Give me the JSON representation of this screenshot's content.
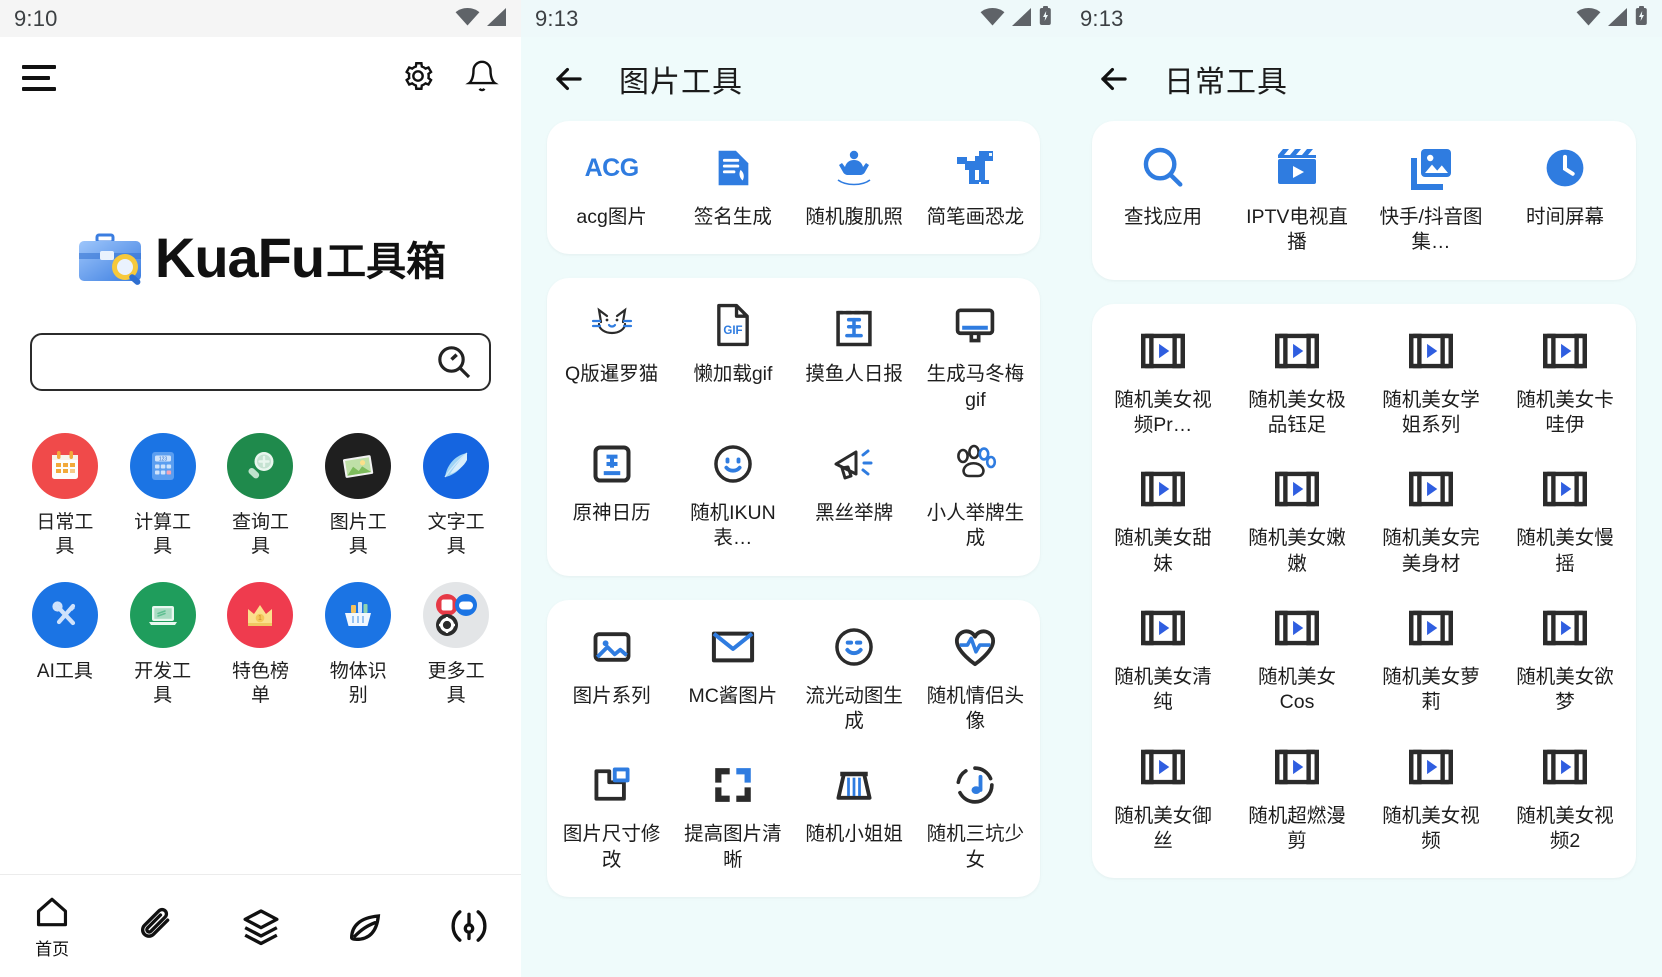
{
  "theme": {
    "accent_blue": "#2f7ce0",
    "panel_bg": "#effbfb",
    "card_bg": "#ffffff",
    "text": "#1d1d1d"
  },
  "panel1": {
    "status": {
      "time": "9:10",
      "icons": [
        "wifi-icon",
        "signal-icon"
      ]
    },
    "appbar": {
      "menu": "menu-icon",
      "settings": "gear-icon",
      "notifications": "bell-icon"
    },
    "brand": {
      "name": "KuaFu",
      "suffix": "工具箱",
      "icon": "briefcase-search-icon"
    },
    "search": {
      "value": "",
      "placeholder": "",
      "button": "search-icon"
    },
    "categories": [
      {
        "label": "日常工具",
        "icon": "calendar-icon",
        "color": "#f04a4a"
      },
      {
        "label": "计算工具",
        "icon": "calculator-icon",
        "color": "#1b74e4"
      },
      {
        "label": "查询工具",
        "icon": "magnifier-plus-icon",
        "color": "#1f8a4c"
      },
      {
        "label": "图片工具",
        "icon": "photo-stack-icon",
        "color": "#1f1f1f"
      },
      {
        "label": "文字工具",
        "icon": "feather-icon",
        "color": "#1565e0"
      },
      {
        "label": "AI工具",
        "icon": "wrench-screwdriver-icon",
        "color": "#1b74e4"
      },
      {
        "label": "开发工具",
        "icon": "laptop-icon",
        "color": "#1f9d5c"
      },
      {
        "label": "特色榜单",
        "icon": "crown-icon",
        "color": "#ef3b4e"
      },
      {
        "label": "物体识别",
        "icon": "basket-icon",
        "color": "#1b74e4"
      },
      {
        "label": "更多工具",
        "icon": "more-apps-icon",
        "color": "#e3e5e7"
      }
    ],
    "bottom_nav": [
      {
        "label": "首页",
        "icon": "home-icon",
        "active": true
      },
      {
        "label": "",
        "icon": "paperclip-icon",
        "active": false
      },
      {
        "label": "",
        "icon": "layers-icon",
        "active": false
      },
      {
        "label": "",
        "icon": "leaf-icon",
        "active": false
      },
      {
        "label": "",
        "icon": "compass-icon",
        "active": false
      }
    ]
  },
  "panel2": {
    "status": {
      "time": "9:13",
      "icons": [
        "wifi-icon",
        "signal-icon",
        "battery-charging-icon"
      ]
    },
    "title": "图片工具",
    "back": "back-arrow-icon",
    "cards": [
      {
        "tools": [
          {
            "label": "acg图片",
            "icon": "acg-text-icon"
          },
          {
            "label": "签名生成",
            "icon": "signature-doc-icon"
          },
          {
            "label": "随机腹肌照",
            "icon": "muscle-flex-icon"
          },
          {
            "label": "简笔画恐龙",
            "icon": "dinosaur-icon"
          }
        ]
      },
      {
        "tools": [
          {
            "label": "Q版暹罗猫",
            "icon": "cat-face-icon"
          },
          {
            "label": "懒加载gif",
            "icon": "gif-file-icon"
          },
          {
            "label": "摸鱼人日报",
            "icon": "calendar-day-icon"
          },
          {
            "label": "生成马冬梅gif",
            "icon": "monitor-icon"
          },
          {
            "label": "原神日历",
            "icon": "day-card-icon"
          },
          {
            "label": "随机IKUN表…",
            "icon": "smiley-icon"
          },
          {
            "label": "黑丝举牌",
            "icon": "megaphone-icon"
          },
          {
            "label": "小人举牌生成",
            "icon": "paw-icon"
          }
        ]
      },
      {
        "tools": [
          {
            "label": "图片系列",
            "icon": "image-icon"
          },
          {
            "label": "MC酱图片",
            "icon": "envelope-icon"
          },
          {
            "label": "流光动图生成",
            "icon": "smiley-round-icon"
          },
          {
            "label": "随机情侣头像",
            "icon": "heart-pulse-icon"
          },
          {
            "label": "图片尺寸修改",
            "icon": "resize-icon"
          },
          {
            "label": "提高图片清晰",
            "icon": "fullscreen-icon"
          },
          {
            "label": "随机小姐姐",
            "icon": "skirt-icon"
          },
          {
            "label": "随机三坑少女",
            "icon": "music-disc-icon"
          }
        ]
      }
    ]
  },
  "panel3": {
    "status": {
      "time": "9:13",
      "icons": [
        "wifi-icon",
        "signal-icon",
        "battery-charging-icon"
      ]
    },
    "title": "日常工具",
    "back": "back-arrow-icon",
    "cards": [
      {
        "tools": [
          {
            "label": "查找应用",
            "icon": "magnifier-icon"
          },
          {
            "label": "IPTV电视直播",
            "icon": "clapboard-play-icon"
          },
          {
            "label": "快手/抖音图集…",
            "icon": "photo-stack-icon"
          },
          {
            "label": "时间屏幕",
            "icon": "clock-icon"
          }
        ]
      },
      {
        "tools": [
          {
            "label": "随机美女视频Pr…",
            "icon": "film-play-icon"
          },
          {
            "label": "随机美女极品钰足",
            "icon": "film-play-icon"
          },
          {
            "label": "随机美女学姐系列",
            "icon": "film-play-icon"
          },
          {
            "label": "随机美女卡哇伊",
            "icon": "film-play-icon"
          },
          {
            "label": "随机美女甜妹",
            "icon": "film-play-icon"
          },
          {
            "label": "随机美女嫩嫩",
            "icon": "film-play-icon"
          },
          {
            "label": "随机美女完美身材",
            "icon": "film-play-icon"
          },
          {
            "label": "随机美女慢摇",
            "icon": "film-play-icon"
          },
          {
            "label": "随机美女清纯",
            "icon": "film-play-icon"
          },
          {
            "label": "随机美女Cos",
            "icon": "film-play-icon"
          },
          {
            "label": "随机美女萝莉",
            "icon": "film-play-icon"
          },
          {
            "label": "随机美女欲梦",
            "icon": "film-play-icon"
          },
          {
            "label": "随机美女御丝",
            "icon": "film-play-icon"
          },
          {
            "label": "随机超燃漫剪",
            "icon": "film-play-icon"
          },
          {
            "label": "随机美女视频",
            "icon": "film-play-icon"
          },
          {
            "label": "随机美女视频2",
            "icon": "film-play-icon"
          }
        ]
      }
    ]
  }
}
